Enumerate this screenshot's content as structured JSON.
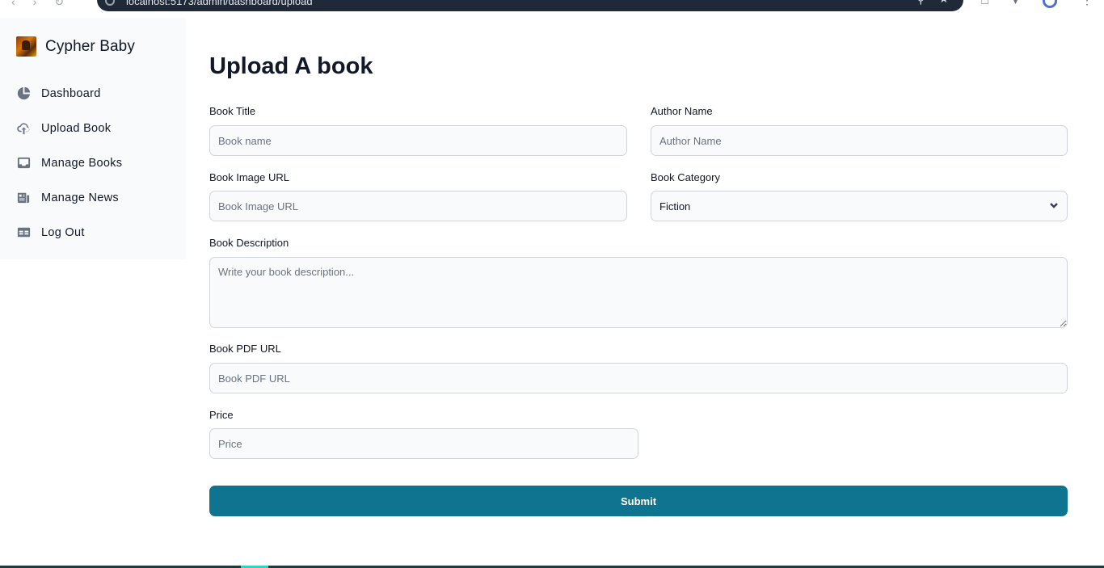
{
  "browser": {
    "url": "localhost:5173/admin/dashboard/upload"
  },
  "sidebar": {
    "brand": "Cypher Baby",
    "items": [
      {
        "label": "Dashboard",
        "icon": "chart-pie-icon"
      },
      {
        "label": "Upload Book",
        "icon": "cloud-upload-icon"
      },
      {
        "label": "Manage Books",
        "icon": "inbox-icon"
      },
      {
        "label": "Manage News",
        "icon": "newspaper-icon"
      },
      {
        "label": "Log Out",
        "icon": "table-icon"
      }
    ]
  },
  "form": {
    "title": "Upload A book",
    "book_title": {
      "label": "Book Title",
      "placeholder": "Book name",
      "value": ""
    },
    "author_name": {
      "label": "Author Name",
      "placeholder": "Author Name",
      "value": ""
    },
    "book_image_url": {
      "label": "Book Image URL",
      "placeholder": "Book Image URL",
      "value": ""
    },
    "book_category": {
      "label": "Book Category",
      "selected": "Fiction"
    },
    "book_description": {
      "label": "Book Description",
      "placeholder": "Write your book description...",
      "value": ""
    },
    "book_pdf_url": {
      "label": "Book PDF URL",
      "placeholder": "Book PDF URL",
      "value": ""
    },
    "price": {
      "label": "Price",
      "placeholder": "Price",
      "value": ""
    },
    "submit_label": "Submit"
  },
  "colors": {
    "accent": "#0e7490",
    "sidebar_bg": "#f9fafb",
    "input_bg": "#f9fafb"
  }
}
